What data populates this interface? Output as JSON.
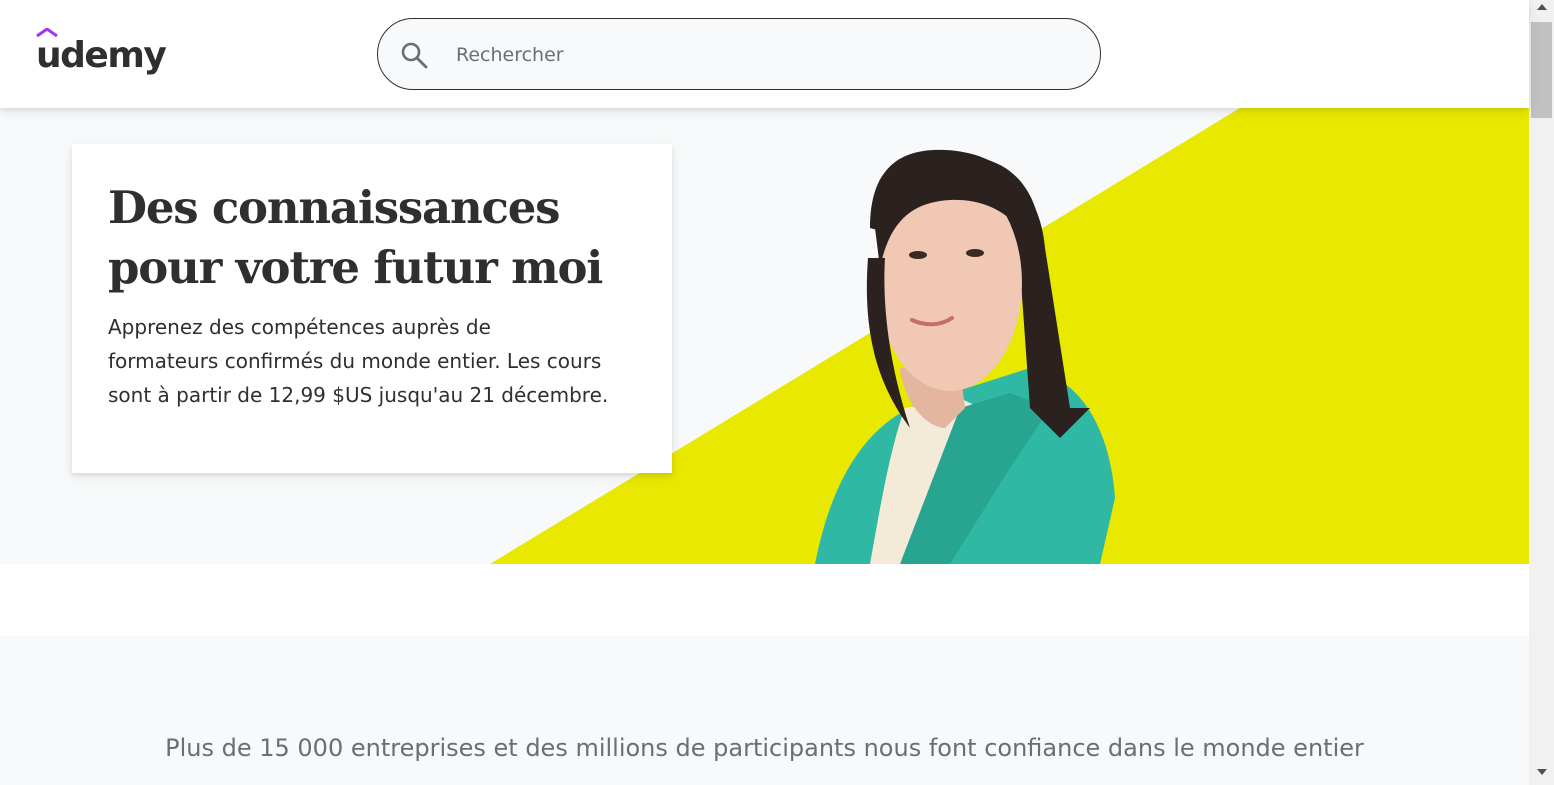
{
  "header": {
    "logo_text": "udemy",
    "search": {
      "placeholder": "Rechercher",
      "value": "",
      "icon": "search-icon"
    }
  },
  "hero": {
    "title_line1": "Des connaissances",
    "title_line2": "pour votre futur moi",
    "text_line1": "Apprenez des compétences auprès de",
    "text_line2": "formateurs confirmés du monde entier. Les cours",
    "text_line3": "sont à partir de 12,99 $US jusqu'au 21 décembre."
  },
  "trust": {
    "text": "Plus de 15 000 entreprises et des millions de participants nous font confiance dans le monde entier"
  },
  "colors": {
    "brand_purple": "#a435f0",
    "accent_yellow": "#e8e800",
    "blazer_teal": "#2fb9a4",
    "text_dark": "#2d2f31",
    "text_muted": "#6a6f73",
    "background_light": "#f7f9fa"
  }
}
